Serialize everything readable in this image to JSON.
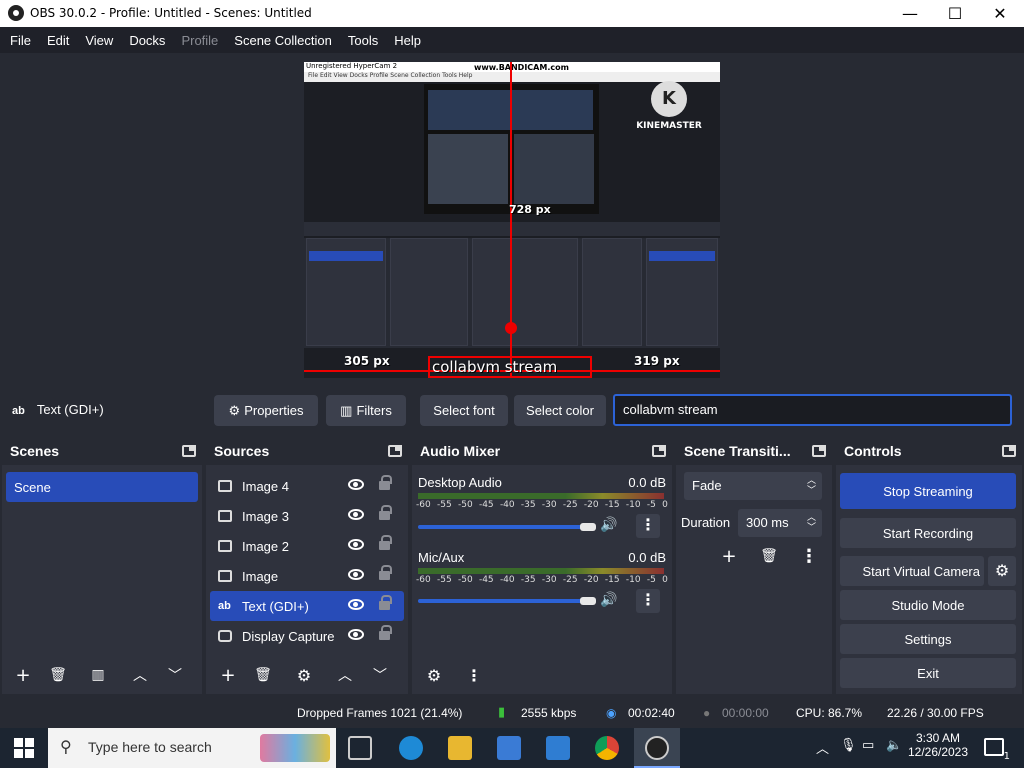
{
  "window": {
    "title": "OBS 30.0.2 - Profile: Untitled - Scenes: Untitled",
    "min": "—",
    "max": "☐",
    "close": "✕"
  },
  "menu": [
    "File",
    "Edit",
    "View",
    "Docks",
    "Profile",
    "Scene Collection",
    "Tools",
    "Help"
  ],
  "preview": {
    "title_text": "Unregistered HyperCam 2",
    "watermark": "www.BANDICAM.com",
    "kinemaster": "KINEMASTER",
    "km_letter": "K",
    "px_top": "728 px",
    "px_left": "305 px",
    "px_right": "319 px",
    "overlay_text": "collabvm stream"
  },
  "toolbar": {
    "source_icon": "ab",
    "source_name": "Text (GDI+)",
    "properties": "Properties",
    "filters": "Filters",
    "select_font": "Select font",
    "select_color": "Select color",
    "text_value": "collabvm stream"
  },
  "scenes": {
    "title": "Scenes",
    "items": [
      "Scene"
    ]
  },
  "sources": {
    "title": "Sources",
    "items": [
      {
        "name": "Image 4",
        "icon": "image-icon"
      },
      {
        "name": "Image 3",
        "icon": "image-icon"
      },
      {
        "name": "Image 2",
        "icon": "image-icon"
      },
      {
        "name": "Image",
        "icon": "image-icon"
      },
      {
        "name": "Text (GDI+)",
        "icon": "text-icon",
        "ab": "ab"
      },
      {
        "name": "Display Capture",
        "icon": "monitor-icon"
      }
    ]
  },
  "audio": {
    "title": "Audio Mixer",
    "channels": [
      {
        "name": "Desktop Audio",
        "db": "0.0 dB",
        "volume": 0.92
      },
      {
        "name": "Mic/Aux",
        "db": "0.0 dB",
        "volume": 0.92
      }
    ],
    "ticks": [
      "-60",
      "-55",
      "-50",
      "-45",
      "-40",
      "-35",
      "-30",
      "-25",
      "-20",
      "-15",
      "-10",
      "-5",
      "0"
    ]
  },
  "transitions": {
    "title": "Scene Transiti...",
    "selected": "Fade",
    "duration_label": "Duration",
    "duration": "300 ms"
  },
  "controls": {
    "title": "Controls",
    "stop_streaming": "Stop Streaming",
    "start_recording": "Start Recording",
    "virtual_camera": "Start Virtual Camera",
    "studio_mode": "Studio Mode",
    "settings": "Settings",
    "exit": "Exit"
  },
  "status": {
    "dropped": "Dropped Frames 1021 (21.4%)",
    "bitrate": "2555 kbps",
    "stream_time": "00:02:40",
    "rec_time": "00:00:00",
    "cpu": "CPU: 86.7%",
    "fps": "22.26 / 30.00 FPS"
  },
  "taskbar": {
    "search_placeholder": "Type here to search",
    "time": "3:30 AM",
    "date": "12/26/2023",
    "notif": "1"
  },
  "colors": {
    "accent": "#284cb8",
    "bg": "#272a33",
    "panel": "#2f323d",
    "red": "#e00000"
  }
}
